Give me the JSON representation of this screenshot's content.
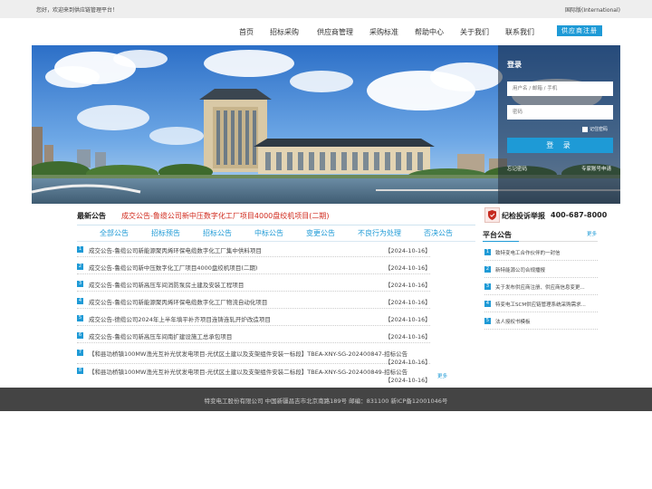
{
  "topbar": {
    "welcome": "您好，欢迎来到供应链管理平台！",
    "intl": "国际版(International)"
  },
  "nav": {
    "items": [
      "首页",
      "招标采购",
      "供应商管理",
      "采购标准",
      "帮助中心",
      "关于我们",
      "联系我们"
    ],
    "register": "供应商注册"
  },
  "login": {
    "title": "登录",
    "user_placeholder": "用户名 / 邮箱 / 手机",
    "pwd_placeholder": "密码",
    "remember": "记住密码",
    "button": "登 录",
    "forgot": "忘记密码",
    "apply": "专家账号申请"
  },
  "latest": {
    "label": "最新公告",
    "text": "成交公告-鲁缆公司新中压数字化工厂项目4000盘绞机项目(二期)"
  },
  "tabs": [
    "全部公告",
    "招标预告",
    "招标公告",
    "中标公告",
    "变更公告",
    "不良行为处理",
    "否决公告"
  ],
  "notices": [
    {
      "num": "1",
      "title": "成交公告-鲁缆公司新能源聚丙烯环保电缆数字化工厂集中供料项目",
      "date": "【2024-10-16】"
    },
    {
      "num": "2",
      "title": "成交公告-鲁缆公司新中压数字化工厂项目4000盘绞机项目(二期)",
      "date": "【2024-10-16】"
    },
    {
      "num": "3",
      "title": "成交公告-鲁缆公司新高压车间消防泵房土建及安装工程项目",
      "date": "【2024-10-16】"
    },
    {
      "num": "4",
      "title": "成交公告-鲁缆公司新能源聚丙烯环保电缆数字化工厂物流自动化项目",
      "date": "【2024-10-16】"
    },
    {
      "num": "5",
      "title": "成交公告-德缆公司2024年上半年填平补齐项目连铸连轧开炉改造项目",
      "date": "【2024-10-16】"
    },
    {
      "num": "6",
      "title": "成交公告-鲁缆公司新高压车间南扩建设施工总承包项目",
      "date": "【2024-10-16】"
    },
    {
      "num": "7",
      "title": "【和县功桥镇100MW渔光互补光伏发电项目-光伏区土建以及支架组件安装一标段】TBEA-XNY-SG-202400847-招标公告",
      "date": "【2024-10-16】"
    },
    {
      "num": "8",
      "title": "【和县功桥镇100MW渔光互补光伏发电项目-光伏区土建以及支架组件安装二标段】TBEA-XNY-SG-202400849-招标公告",
      "date": "【2024-10-16】"
    }
  ],
  "more_label": "更多",
  "hotline": {
    "label": "纪检投诉举报",
    "number": "400-687-8000"
  },
  "platform": {
    "title": "平台公告",
    "more": "更多",
    "items": [
      {
        "num": "1",
        "title": "致特变电工合作伙伴的一封信"
      },
      {
        "num": "2",
        "title": "新特能源公司合规播报"
      },
      {
        "num": "3",
        "title": "关于发布供应商注册、供应商信息变更..."
      },
      {
        "num": "4",
        "title": "特变电工SCM供应链管理系统采购需求..."
      },
      {
        "num": "5",
        "title": "法人授权书模板"
      }
    ]
  },
  "footer": {
    "text": "特变电工股份有限公司   中国新疆昌吉市北京南路189号   邮编：831100   新ICP备12001046号"
  },
  "colors": {
    "accent": "#1e9ad6",
    "latest_red": "#d0291c",
    "footer_bg": "#444444"
  }
}
